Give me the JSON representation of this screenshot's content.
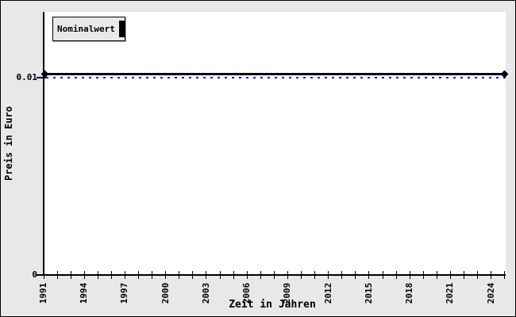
{
  "canvas": {
    "background_color": "#e8e8e8",
    "plot_background_color": "#ffffff",
    "border_color": "#000000"
  },
  "legend": {
    "label": "Nominalwert",
    "marker": "filled-bar",
    "marker_color": "#000000"
  },
  "chart_data": {
    "type": "line",
    "title": "",
    "xlabel": "Zeit in Jahren",
    "ylabel": "Preis in Euro",
    "x_range": [
      1991,
      2025
    ],
    "x_minor_tick_step": 1,
    "x_major_ticks": [
      1991,
      1994,
      1997,
      2000,
      2003,
      2006,
      2009,
      2012,
      2015,
      2018,
      2021,
      2024
    ],
    "y_ticks": [
      {
        "label": "0.01",
        "value": 0.01
      },
      {
        "label": "0",
        "value": 0
      }
    ],
    "ylim": [
      0,
      0.0133
    ],
    "grid": "off",
    "legend_position": "top-left",
    "series": [
      {
        "name": "Nominalwert",
        "color": "#000000",
        "line_style": "solid",
        "line_width": 3,
        "marker": "diamond",
        "x": [
          1991,
          2025
        ],
        "y": [
          0.0102,
          0.0102
        ]
      }
    ],
    "reference_line": {
      "value": 0.01,
      "color": "#0000ff",
      "style": "dotted"
    }
  }
}
